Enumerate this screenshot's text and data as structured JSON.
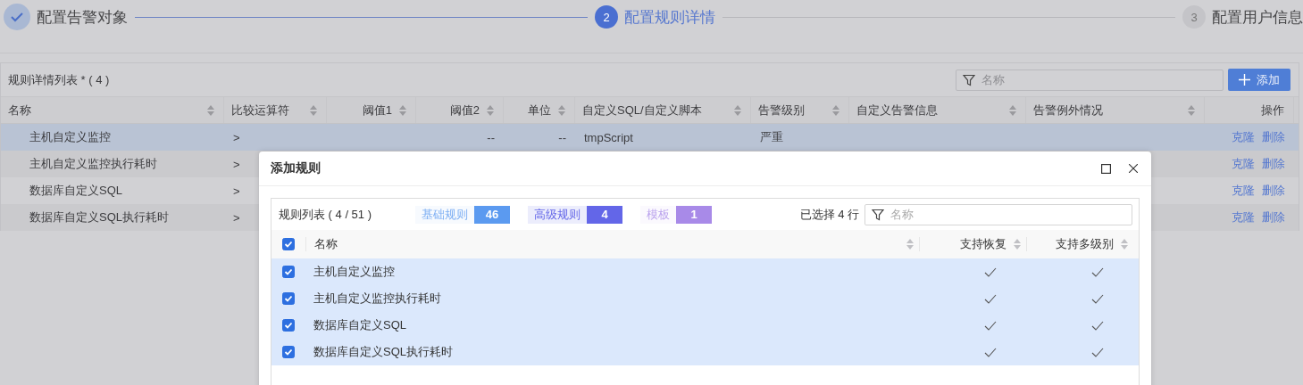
{
  "steps": [
    {
      "label": "配置告警对象",
      "kind": "done"
    },
    {
      "number": "2",
      "label": "配置规则详情",
      "kind": "active"
    },
    {
      "number": "3",
      "label": "配置用户信息",
      "kind": "pending"
    }
  ],
  "panel": {
    "title": "规则详情列表 * ( 4 )",
    "search": {
      "placeholder": "名称"
    },
    "add_button": "添加"
  },
  "table": {
    "columns": [
      {
        "label": "名称",
        "sortable": true
      },
      {
        "label": "比较运算符",
        "sortable": true
      },
      {
        "label": "阈值1",
        "sortable": true
      },
      {
        "label": "阈值2",
        "sortable": true
      },
      {
        "label": "单位",
        "sortable": true
      },
      {
        "label": "自定义SQL/自定义脚本",
        "sortable": true
      },
      {
        "label": "告警级别",
        "sortable": true
      },
      {
        "label": "自定义告警信息",
        "sortable": true
      },
      {
        "label": "告警例外情况",
        "sortable": true
      },
      {
        "label": "操作",
        "sortable": false
      }
    ],
    "rows": [
      {
        "selected": true,
        "name": "主机自定义监控",
        "operator": ">",
        "threshold_2": "--",
        "unit": "--",
        "script": "tmpScript",
        "level": "严重",
        "actions": [
          "克隆",
          "删除"
        ]
      },
      {
        "selected": false,
        "name": "主机自定义监控执行耗时",
        "operator": ">",
        "actions": [
          "克隆",
          "删除"
        ]
      },
      {
        "selected": false,
        "name": "数据库自定义SQL",
        "operator": ">",
        "actions": [
          "克隆",
          "删除"
        ]
      },
      {
        "selected": false,
        "name": "数据库自定义SQL执行耗时",
        "operator": ">",
        "actions": [
          "克隆",
          "删除"
        ]
      }
    ]
  },
  "dialog": {
    "title": "添加规则",
    "list_title": "规则列表 ( 4 / 51 )",
    "filters": [
      {
        "label": "基础规则",
        "count": "46",
        "selected": false,
        "color": "#5b9af0"
      },
      {
        "label": "高级规则",
        "count": "4",
        "selected": true,
        "color": "#6366e8"
      },
      {
        "label": "模板",
        "count": "1",
        "selected": false,
        "color": "#a88ae8"
      }
    ],
    "selection_count": "已选择 4 行",
    "search": {
      "placeholder": "名称"
    },
    "all_checked": true,
    "columns": [
      "名称",
      "支持恢复",
      "支持多级别"
    ],
    "rows": [
      {
        "checked": true,
        "selected": true,
        "name": "主机自定义监控",
        "recoverable": true,
        "multilevel": true
      },
      {
        "checked": true,
        "selected": true,
        "name": "主机自定义监控执行耗时",
        "recoverable": true,
        "multilevel": true
      },
      {
        "checked": true,
        "selected": true,
        "name": "数据库自定义SQL",
        "recoverable": true,
        "multilevel": true
      },
      {
        "checked": true,
        "selected": true,
        "name": "数据库自定义SQL执行耗时",
        "recoverable": true,
        "multilevel": true
      }
    ]
  }
}
